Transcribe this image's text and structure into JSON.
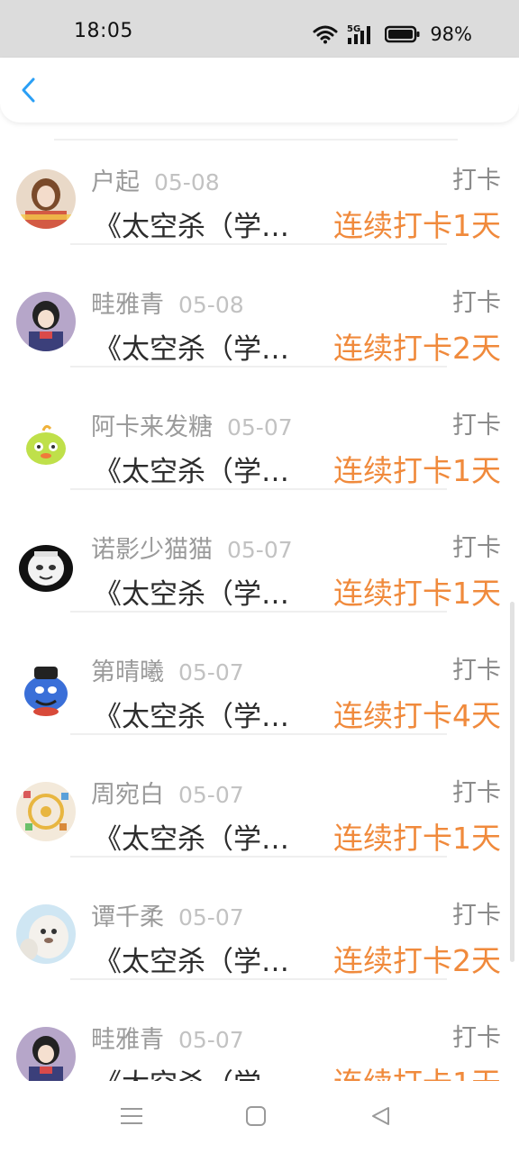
{
  "status_bar": {
    "time": "18:05",
    "battery_percent": "98%",
    "network": "5G",
    "icons": [
      "wifi-icon",
      "signal-5g-icon",
      "battery-icon"
    ]
  },
  "header": {
    "back_icon": "chevron-left-icon",
    "accent_color": "#2a9ff5"
  },
  "colors": {
    "streak": "#f08a3c",
    "name": "#9a9a9a",
    "date": "#c2c2c2",
    "title": "#2c2c2c"
  },
  "list": {
    "items": [
      {
        "name": "户起",
        "date": "05-08",
        "action": "打卡",
        "title": "《太空杀（学生版）》",
        "streak": "连续打卡1天"
      },
      {
        "name": "畦雅青",
        "date": "05-08",
        "action": "打卡",
        "title": "《太空杀（学生版）》",
        "streak": "连续打卡2天"
      },
      {
        "name": "阿卡来发糖",
        "date": "05-07",
        "action": "打卡",
        "title": "《太空杀（学生版）》",
        "streak": "连续打卡1天"
      },
      {
        "name": "诺影少猫猫",
        "date": "05-07",
        "action": "打卡",
        "title": "《太空杀（学生版）》",
        "streak": "连续打卡1天"
      },
      {
        "name": "第晴曦",
        "date": "05-07",
        "action": "打卡",
        "title": "《太空杀（学生版）》",
        "streak": "连续打卡4天"
      },
      {
        "name": "周宛白",
        "date": "05-07",
        "action": "打卡",
        "title": "《太空杀（学生版）》",
        "streak": "连续打卡1天"
      },
      {
        "name": "谭千柔",
        "date": "05-07",
        "action": "打卡",
        "title": "《太空杀（学生版）》",
        "streak": "连续打卡2天"
      },
      {
        "name": "畦雅青",
        "date": "05-07",
        "action": "打卡",
        "title": "《太空杀（学生版）》",
        "streak": "连续打卡1天"
      }
    ]
  },
  "nav_bar": {
    "icons": [
      "menu-icon",
      "home-icon",
      "back-triangle-icon"
    ]
  }
}
